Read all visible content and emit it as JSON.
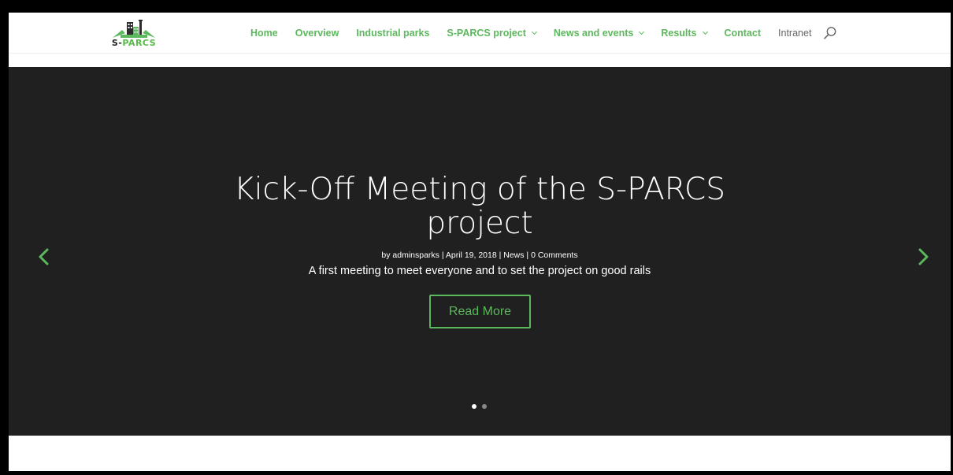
{
  "brand": {
    "logo_prefix": "S-",
    "logo_suffix": "PARCS",
    "colors": {
      "accent": "#5cb85c",
      "hero_bg": "#202020"
    }
  },
  "nav": {
    "items": [
      {
        "label": "Home",
        "dropdown": false
      },
      {
        "label": "Overview",
        "dropdown": false
      },
      {
        "label": "Industrial parks",
        "dropdown": false
      },
      {
        "label": "S-PARCS project",
        "dropdown": true
      },
      {
        "label": "News and events",
        "dropdown": true
      },
      {
        "label": "Results",
        "dropdown": true
      },
      {
        "label": "Contact",
        "dropdown": false
      }
    ],
    "intranet_label": "Intranet",
    "search_icon": "search-icon"
  },
  "slider": {
    "title_line1": "Kick-Off Meeting of the S-PARCS",
    "title_line2": "project",
    "meta": "by adminsparks | April 19, 2018 | News | 0 Comments",
    "excerpt": "A first meeting to meet everyone and to set the project on good rails",
    "button_label": "Read More",
    "prev_icon": "chevron-left-icon",
    "next_icon": "chevron-right-icon",
    "slide_count": 2,
    "active_slide": 1
  }
}
